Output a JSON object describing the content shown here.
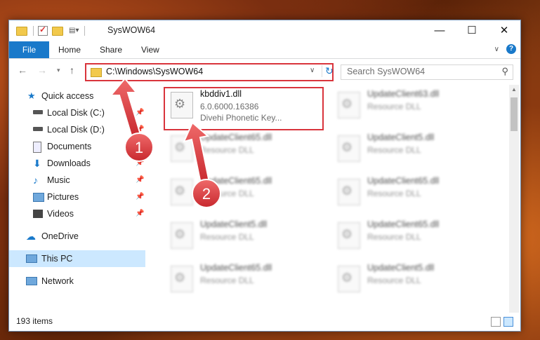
{
  "title": "SysWOW64",
  "window_controls": {
    "minimize": "—",
    "maximize": "☐",
    "close": "✕"
  },
  "ribbon": {
    "file": "File",
    "tabs": [
      "Home",
      "Share",
      "View"
    ],
    "help": "?"
  },
  "address": {
    "path": "C:\\Windows\\SysWOW64"
  },
  "search": {
    "placeholder": "Search SysWOW64"
  },
  "sidebar": {
    "items": [
      {
        "label": "Quick access",
        "icon": "star-icon",
        "pinned": false
      },
      {
        "label": "Local Disk (C:)",
        "icon": "drive-icon",
        "pinned": true
      },
      {
        "label": "Local Disk (D:)",
        "icon": "drive-icon",
        "pinned": true
      },
      {
        "label": "Documents",
        "icon": "documents-icon",
        "pinned": true
      },
      {
        "label": "Downloads",
        "icon": "download-icon",
        "pinned": true
      },
      {
        "label": "Music",
        "icon": "music-icon",
        "pinned": true
      },
      {
        "label": "Pictures",
        "icon": "pictures-icon",
        "pinned": true
      },
      {
        "label": "Videos",
        "icon": "videos-icon",
        "pinned": true
      },
      {
        "label": "OneDrive",
        "icon": "onedrive-icon",
        "pinned": false
      },
      {
        "label": "This PC",
        "icon": "computer-icon",
        "pinned": false
      },
      {
        "label": "Network",
        "icon": "network-icon",
        "pinned": false
      }
    ]
  },
  "files": {
    "highlighted": {
      "name": "kbddiv1.dll",
      "version": "6.0.6000.16386",
      "description": "Divehi Phonetic Key..."
    },
    "blurred_left": [
      {
        "name": "UpdateClient65.dll",
        "type": "Resource DLL"
      },
      {
        "name": "UpdateClient65.dll",
        "type": "Resource DLL"
      },
      {
        "name": "UpdateClient5.dll",
        "type": "Resource DLL"
      },
      {
        "name": "UpdateClient65.dll",
        "type": "Resource DLL"
      }
    ],
    "blurred_right": [
      {
        "name": "UpdateClient63.dll",
        "type": "Resource DLL"
      },
      {
        "name": "UpdateClient5.dll",
        "type": "Resource DLL"
      },
      {
        "name": "UpdateClient65.dll",
        "type": "Resource DLL"
      },
      {
        "name": "UpdateClient65.dll",
        "type": "Resource DLL"
      },
      {
        "name": "UpdateClient5.dll",
        "type": "Resource DLL"
      }
    ]
  },
  "status": {
    "items_count": "193 items"
  },
  "annotations": {
    "step1": "1",
    "step2": "2"
  },
  "colors": {
    "accent": "#1979ca",
    "highlight": "#d9343c",
    "selected": "#cce8ff"
  }
}
